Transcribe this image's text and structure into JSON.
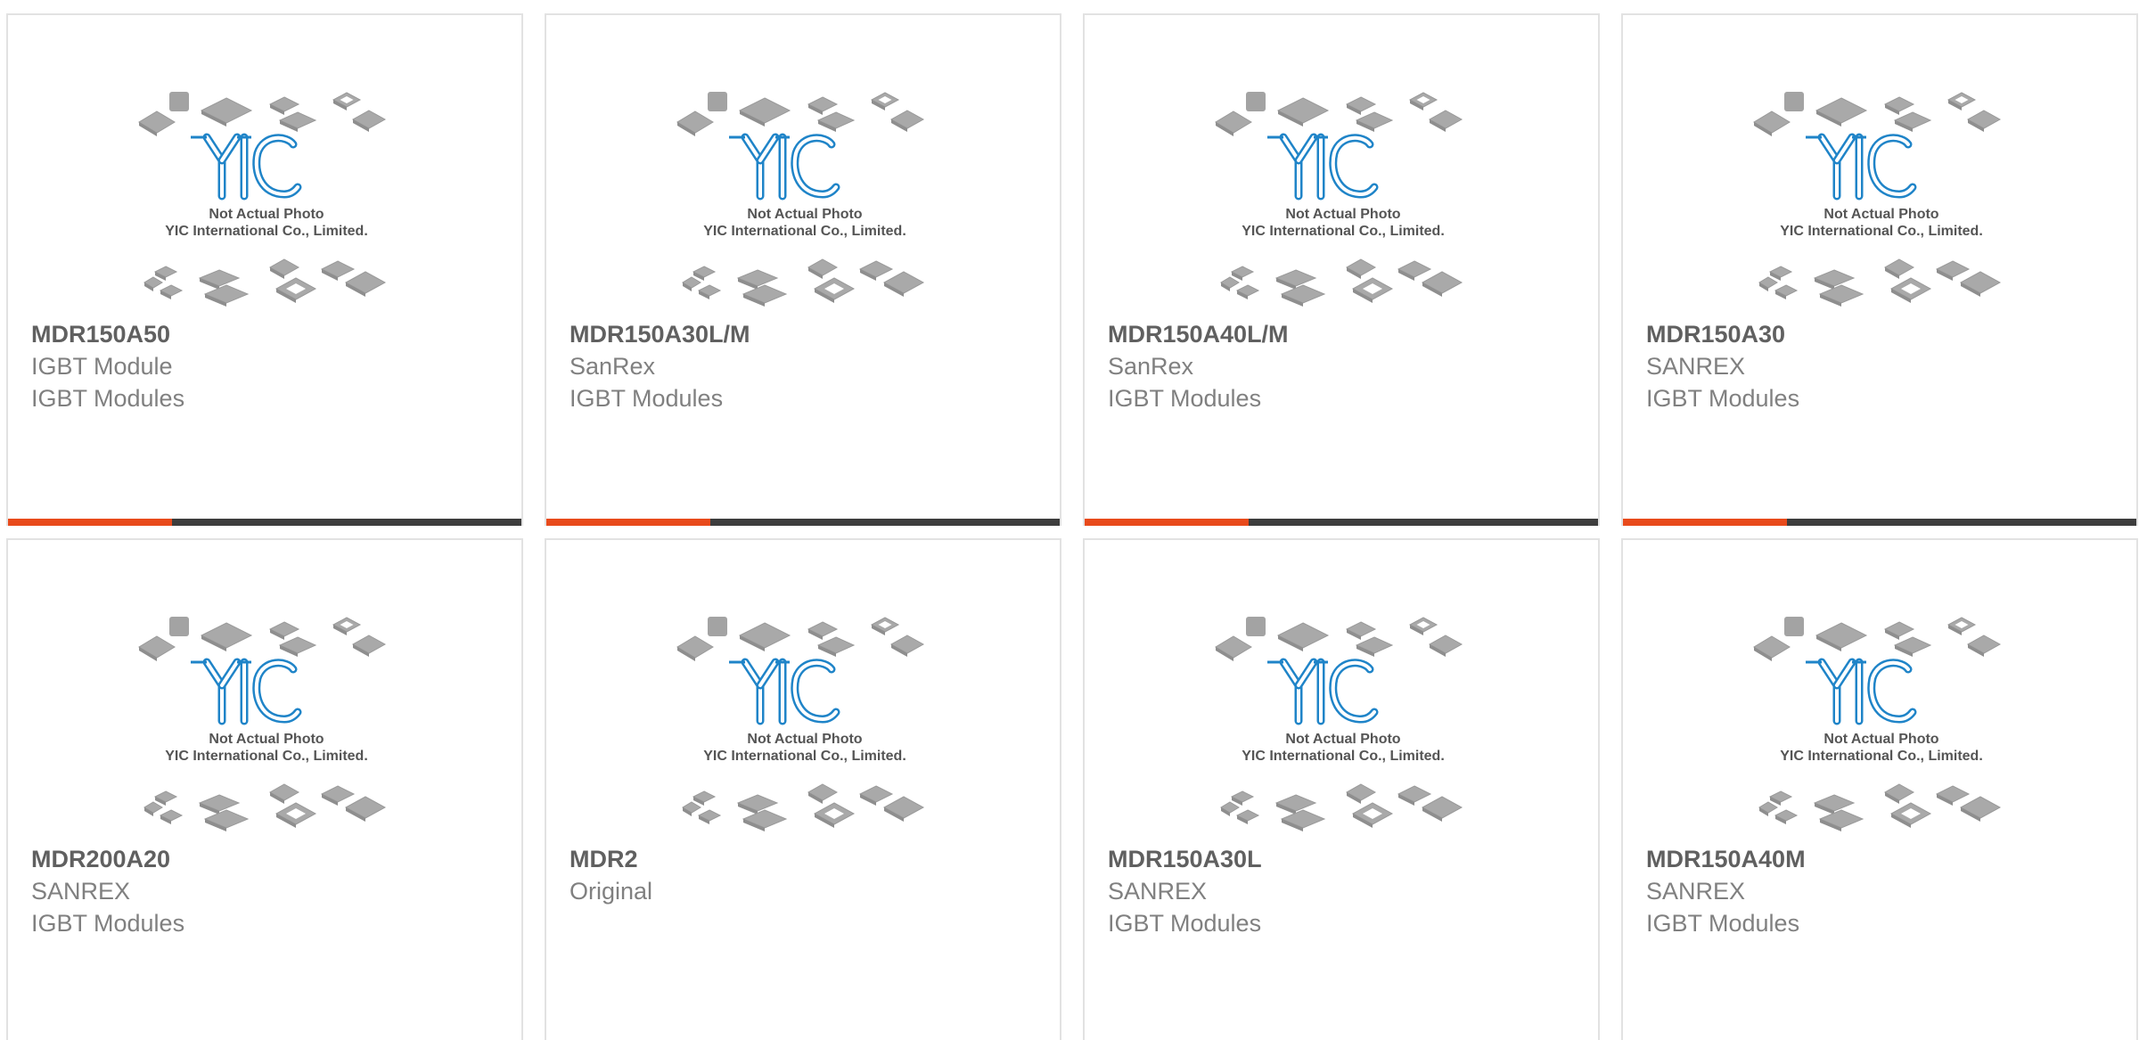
{
  "theme": {
    "accent": "#e84a1b",
    "bar_dark": "#3d3d3d",
    "logo_blue": "#1f84c8"
  },
  "thumbnail": {
    "logo_text": "YIC",
    "caption_line1": "Not Actual Photo",
    "caption_line2": "YIC International Co., Limited."
  },
  "products": [
    {
      "part_number": "MDR150A50",
      "line1": "IGBT Module",
      "line2": "IGBT Modules",
      "has_bar": true
    },
    {
      "part_number": "MDR150A30L/M",
      "line1": "SanRex",
      "line2": "IGBT Modules",
      "has_bar": true
    },
    {
      "part_number": "MDR150A40L/M",
      "line1": "SanRex",
      "line2": "IGBT Modules",
      "has_bar": true
    },
    {
      "part_number": "MDR150A30",
      "line1": "SANREX",
      "line2": "IGBT Modules",
      "has_bar": true
    },
    {
      "part_number": "MDR200A20",
      "line1": "SANREX",
      "line2": "IGBT Modules",
      "has_bar": false
    },
    {
      "part_number": "MDR2",
      "line1": "Original",
      "line2": "",
      "has_bar": false
    },
    {
      "part_number": "MDR150A30L",
      "line1": "SANREX",
      "line2": "IGBT Modules",
      "has_bar": false
    },
    {
      "part_number": "MDR150A40M",
      "line1": "SANREX",
      "line2": "IGBT Modules",
      "has_bar": false
    }
  ]
}
